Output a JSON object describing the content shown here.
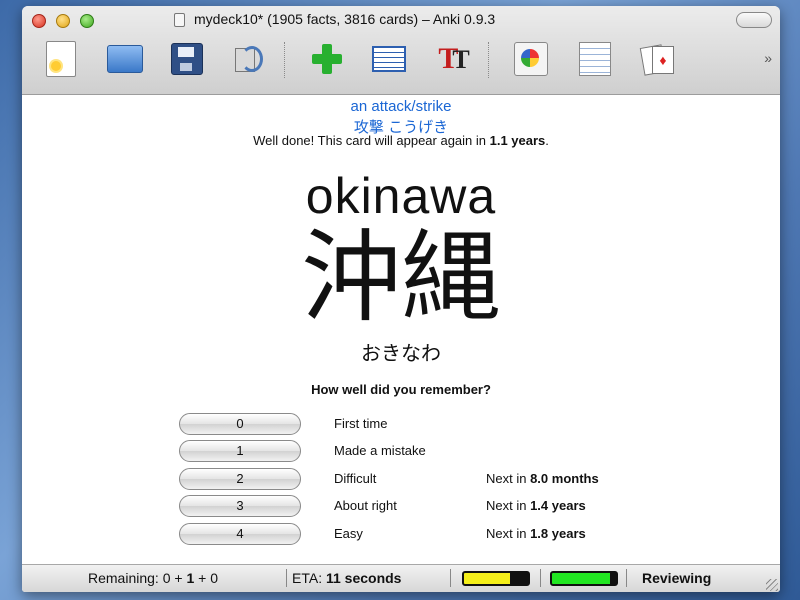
{
  "window": {
    "title": "mydeck10* (1905 facts, 3816 cards) – Anki 0.9.3"
  },
  "toolbar": {
    "buttons": [
      {
        "name": "new-deck",
        "icon": "new-document-icon"
      },
      {
        "name": "open-deck",
        "icon": "open-folder-icon"
      },
      {
        "name": "save-deck",
        "icon": "floppy-save-icon"
      },
      {
        "name": "sync",
        "icon": "sync-icon"
      },
      {
        "name": "add-items",
        "icon": "green-plus-icon"
      },
      {
        "name": "browse-items",
        "icon": "list-browse-icon"
      },
      {
        "name": "font-properties",
        "icon": "font-tt-icon"
      },
      {
        "name": "graphs",
        "icon": "graph-icon"
      },
      {
        "name": "card-list",
        "icon": "table-icon"
      },
      {
        "name": "cards",
        "icon": "playing-cards-icon"
      }
    ],
    "overflow_glyph": "»"
  },
  "card": {
    "meaning": "an attack/strike",
    "reading": "攻撃 こうげき",
    "message_prefix": "Well done! This card will appear again in ",
    "message_interval": "1.1 years",
    "message_suffix": ".",
    "romaji": "okinawa",
    "kanji": "沖縄",
    "kana": "おきなわ"
  },
  "answers": {
    "question": "How well did you remember?",
    "options": [
      {
        "key": "0",
        "label": "First time",
        "next_prefix": "",
        "next_value": ""
      },
      {
        "key": "1",
        "label": "Made a mistake",
        "next_prefix": "",
        "next_value": ""
      },
      {
        "key": "2",
        "label": "Difficult",
        "next_prefix": "Next in ",
        "next_value": "8.0 months"
      },
      {
        "key": "3",
        "label": "About right",
        "next_prefix": "Next in ",
        "next_value": "1.4 years"
      },
      {
        "key": "4",
        "label": "Easy",
        "next_prefix": "Next in ",
        "next_value": "1.8 years"
      }
    ]
  },
  "status": {
    "remaining_label": "Remaining: ",
    "remaining_a": "0",
    "remaining_plus1": " + ",
    "remaining_b": "1",
    "remaining_plus2": " + ",
    "remaining_c": "0",
    "eta_label": "ETA: ",
    "eta_value": "11 seconds",
    "progress1": {
      "fraction": 0.72,
      "color": "#f4ee1a"
    },
    "progress2": {
      "fraction": 0.9,
      "color": "#22e622"
    },
    "mode": "Reviewing"
  },
  "colors": {
    "link_blue": "#1a66d4"
  }
}
